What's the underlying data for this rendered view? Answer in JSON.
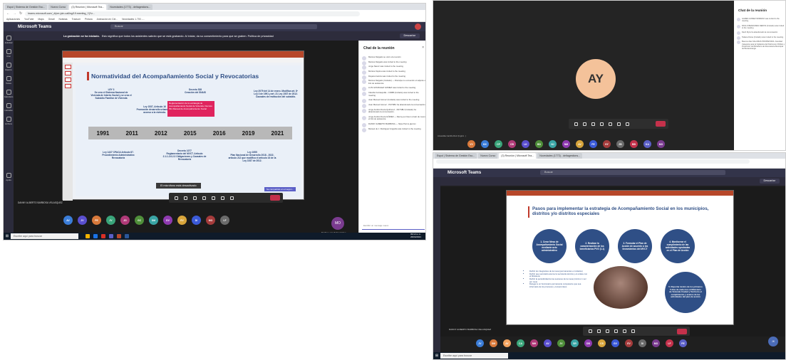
{
  "s1": {
    "tabs": [
      "Espol | Sistema de Gestión Esc...",
      "Nuevo Curso",
      "(3) Reunión | Microsoft Tea...",
      "Novedades (1773) - deltagestions..."
    ],
    "address": "teams.microsoft.com/_#/pre-join-calling/19:meeting_YjYz...",
    "bookmarks": [
      "Aplicaciones",
      "YouTube",
      "Maps",
      "Gmail",
      "Noticias",
      "Traducir",
      "Pintura",
      "Animación en Cel...",
      "Novedades 1.700 -..."
    ],
    "app_title": "Microsoft Teams",
    "search_placeholder": "Buscar",
    "rec_banner_bold": "La grabación se ha iniciado.",
    "rec_banner_text": "Esto significa que todos los asistentes sabrán que se está grabando. Al iniciar, da su consentimiento para que se graben. Política de privacidad",
    "dismiss": "Descartar",
    "rail": [
      "Actividad",
      "Chat",
      "Equipos",
      "Tareas",
      "Calendario",
      "Llamadas",
      "Archivos",
      "Ayuda"
    ],
    "slide_title": "Normatividad del Acompañamiento Social y Revocatorias",
    "boxes": {
      "ley3": "LEY 3\nSe crea el Sistema Nacional de Vivienda de Interés Social y se crea el Subsidio Familiar de Vivienda",
      "ley1537": "Ley 1537, Artículo 16\nPromoción desarrollo urbano y el acceso a la vivienda.",
      "decreto528": "Decreto 528\nCreación del SNAIS",
      "red": "Reglamentación de la estrategia de Acompañamiento Social de Vivienda. Decreto 561 Manual de Acompañamiento Social",
      "ley2079": "Ley 2079 del 14 de enero. Modifica art. 8º Ley 3 de 1991 y art. 21 Ley 1537 de 2012. Causales de restitución del subsidio.",
      "ley1437": "Ley 1437 CPACA Artículo 87. Procedimiento Administrativo Revocatoria",
      "decreto1077": "Decreto 1077\nReglamentario del MVCT. Artículo 2.1.1.2.6.2.3 Obligaciones y Causales de Revocatoria",
      "ley1955": "Ley 1955\nPlan Nacional de Desarrollo 2018 - 2022, artículo 212 que modifica el artículo 16 de la Ley 1537 de 2012."
    },
    "years": [
      "1991",
      "2011",
      "2012",
      "2015",
      "2016",
      "2019",
      "2021"
    ],
    "muted_toast": "El micrófono está desactivado",
    "share_label": "Se compartido en el segun...",
    "presenter": "DANNY ALBERTO BARBOSA VELASQUEZ",
    "participants": [
      "AV",
      "JV",
      "PE",
      "JV",
      "JG",
      "GC",
      "DM",
      "DV",
      "EV",
      "DI",
      "MO",
      "LF"
    ],
    "participant_colors": [
      "#3b7dd8",
      "#5a4fcf",
      "#d8793b",
      "#3aa57a",
      "#b03a78",
      "#4f8f3a",
      "#3aa5a5",
      "#8f3ab0",
      "#d8a53b",
      "#3b5ad8",
      "#a53b3b",
      "#6b6b6b"
    ],
    "self_initials": "MO",
    "self_name": "Martha Lucía Ibañez Ochoa",
    "chat_title": "Chat de la reunión",
    "chat_items": [
      "Marcos Delgado se unió a la reunión",
      "Marcos Delgado was invited to the meeting",
      "Jorge Sáenz was invited to the meeting",
      "Mónica Ospina was invited to the meeting",
      "Dayana García was invited to the meeting",
      "Marcos Delgado (Invitado) — Disculpe no encuentro el adjunto o link de asistencia",
      "LUIS GONZALEZ GOMEZ was invited to the meeting",
      "Claudia Carrasquilla - CDMB (Invitado) was invited to the meeting",
      "Juan Manuel Gómez (Invitado) was invited to the meeting",
      "Juan Manuel Gómez - PAYSBU ha abandonado la conversación.",
      "Jorge Andrés Devia Quiñonez - PAYSBU (Invitado) ha abandonado la conversación.",
      "Jorge Andrés Devia GÓMEZ — Danny por favor enviar de nuevo el link de asistencia",
      "DANNY ALBERTO BARBOSA — https://forms.gle/xxx",
      "Manuel de J. Rodriguez Angarita was invited to the meeting"
    ],
    "chat_input": "Escribir un mensaje nuevo",
    "taskbar_search": "Escribe aquí para buscar",
    "clock_time": "09:12 a. m.",
    "clock_date": "26/04/2021"
  },
  "s2": {
    "avatar_initials": "AY",
    "name": "Amandita Carrillo Ruiz (Ingrid.. )",
    "chat_title": "Chat de la reunión",
    "chat_items": [
      "GAMES GOMEZ MORENO was invited to the meeting",
      "PAOLO BENAVIDES DEROS (Invitado) was invited to the meeting",
      "Danh Myra ha abandonado la conversación",
      "Tatiana Dorsa (Invitado) was invited to the meeting",
      "Buenos días SALUMAS PROPIETARIA. Facultad Categoria para la Vigilancia del Patrimonio Público y Protección del Ministerio de Revocatoria Municipal de Bucaramanga"
    ],
    "participants": [
      "VV",
      "KK",
      "CP",
      "CB",
      "LK",
      "BD",
      "NJ",
      "NM",
      "AV",
      "PE",
      "HY",
      "ZB",
      "BB",
      "KA",
      "MO"
    ],
    "participant_colors": [
      "#d8793b",
      "#3b7dd8",
      "#3aa57a",
      "#b03a78",
      "#5a4fcf",
      "#4f8f3a",
      "#3aa5a5",
      "#8f3ab0",
      "#d8a53b",
      "#3b5ad8",
      "#a53b3b",
      "#6b6b6b",
      "#c4314b",
      "#5b5fc7",
      "#7a3b8f"
    ]
  },
  "s3": {
    "tabs": [
      "Espol | Sistema de Gestión Esc...",
      "Nuevo Curso",
      "(3) Reunión | Microsoft Tea...",
      "Novedades (1773) - deltagestions..."
    ],
    "app_title": "Microsoft Teams",
    "search_placeholder": "Buscar",
    "dismiss": "Descartar",
    "slide_title": "Pasos para implementar la estrategia de Acompañamiento Social en los municipios, distritos y/o distritos especiales",
    "steps": [
      "1. Crear Mesa de Acompañamiento Social mediante acto administrativo",
      "2. Realizar la caracterización de los beneficiarios PVG (1.1)",
      "3. Formular el Plan de Acción de acuerdo a los lineamientos del MVCT",
      "4. Monitorear el cumplimiento de las actividades aprobadas en el Plan de Acción",
      "5. Reportar dentro de los primeros 5 días de cada mes al Ministerio de Vivienda Ciudad y Territorio el cumplimiento y avance de las actividades del plan de acción"
    ],
    "bullets": [
      "Definir los integrantes de la mesa (permanentes e invitados)",
      "Definir que secretaría asume la secretaría técnica y el enlace con el Ministerio",
      "Definir la periodicidad de las sesiones de la mesa (mínimo 1 vez por mes)",
      "Delegar a un funcionario permanente competente que sea informado de los procesos y compromisos"
    ],
    "presenter": "DANNY ALBERTO BARBOSA VELASQUEZ",
    "participants": [
      "JV",
      "DM",
      "AY",
      "CA",
      "MH",
      "AV",
      "JV",
      "SR",
      "DB",
      "CS",
      "GV",
      "EV",
      "DI",
      "MO",
      "LF",
      "PE"
    ],
    "participant_colors": [
      "#3b7dd8",
      "#d8793b",
      "#f4a460",
      "#3aa57a",
      "#b03a78",
      "#5a4fcf",
      "#4f8f3a",
      "#3aa5a5",
      "#8f3ab0",
      "#d8a53b",
      "#3b5ad8",
      "#a53b3b",
      "#6b6b6b",
      "#7a3b8f",
      "#c4314b",
      "#5b5fc7"
    ],
    "self_initials": "JK",
    "taskbar_search": "Escribe aquí para buscar"
  }
}
